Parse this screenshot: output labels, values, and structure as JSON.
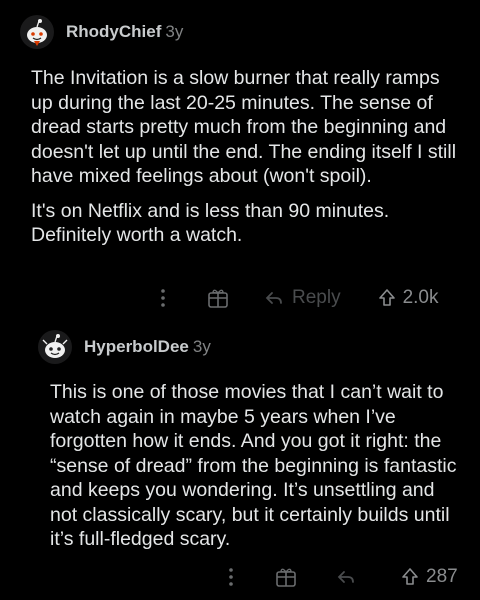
{
  "comments": [
    {
      "username": "RhodyChief",
      "age": "3y",
      "paragraphs": [
        "The Invitation is a slow burner that really ramps up during the last 20-25 minutes. The sense of dread starts pretty much from the beginning and doesn't let up until the end. The ending itself I still have mixed feelings about (won't spoil).",
        "It's on Netflix and is less than 90 minutes. Definitely worth a watch."
      ],
      "actions": {
        "more_icon": "more-vertical-icon",
        "award_icon": "gift-icon",
        "reply_icon": "reply-arrow-icon",
        "reply_label": "Reply",
        "upvote_icon": "upvote-arrow-icon",
        "votes": "2.0k"
      }
    },
    {
      "username": "HyperbolDee",
      "age": "3y",
      "paragraphs": [
        "This is one of those movies that I can’t wait to watch again in maybe 5 years when I’ve forgotten how it ends. And you got it right: the “sense of dread” from the beginning is fantastic and keeps you wondering. It’s unsettling and not classically scary, but it certainly builds until it’s full-fledged scary."
      ],
      "actions": {
        "more_icon": "more-vertical-icon",
        "award_icon": "gift-icon",
        "reply_icon": "reply-arrow-icon",
        "upvote_icon": "upvote-arrow-icon",
        "votes": "287"
      }
    }
  ],
  "colors": {
    "background": "#000000",
    "text": "#e4e6e7",
    "meta": "#818384",
    "actions": "#5d6062"
  }
}
